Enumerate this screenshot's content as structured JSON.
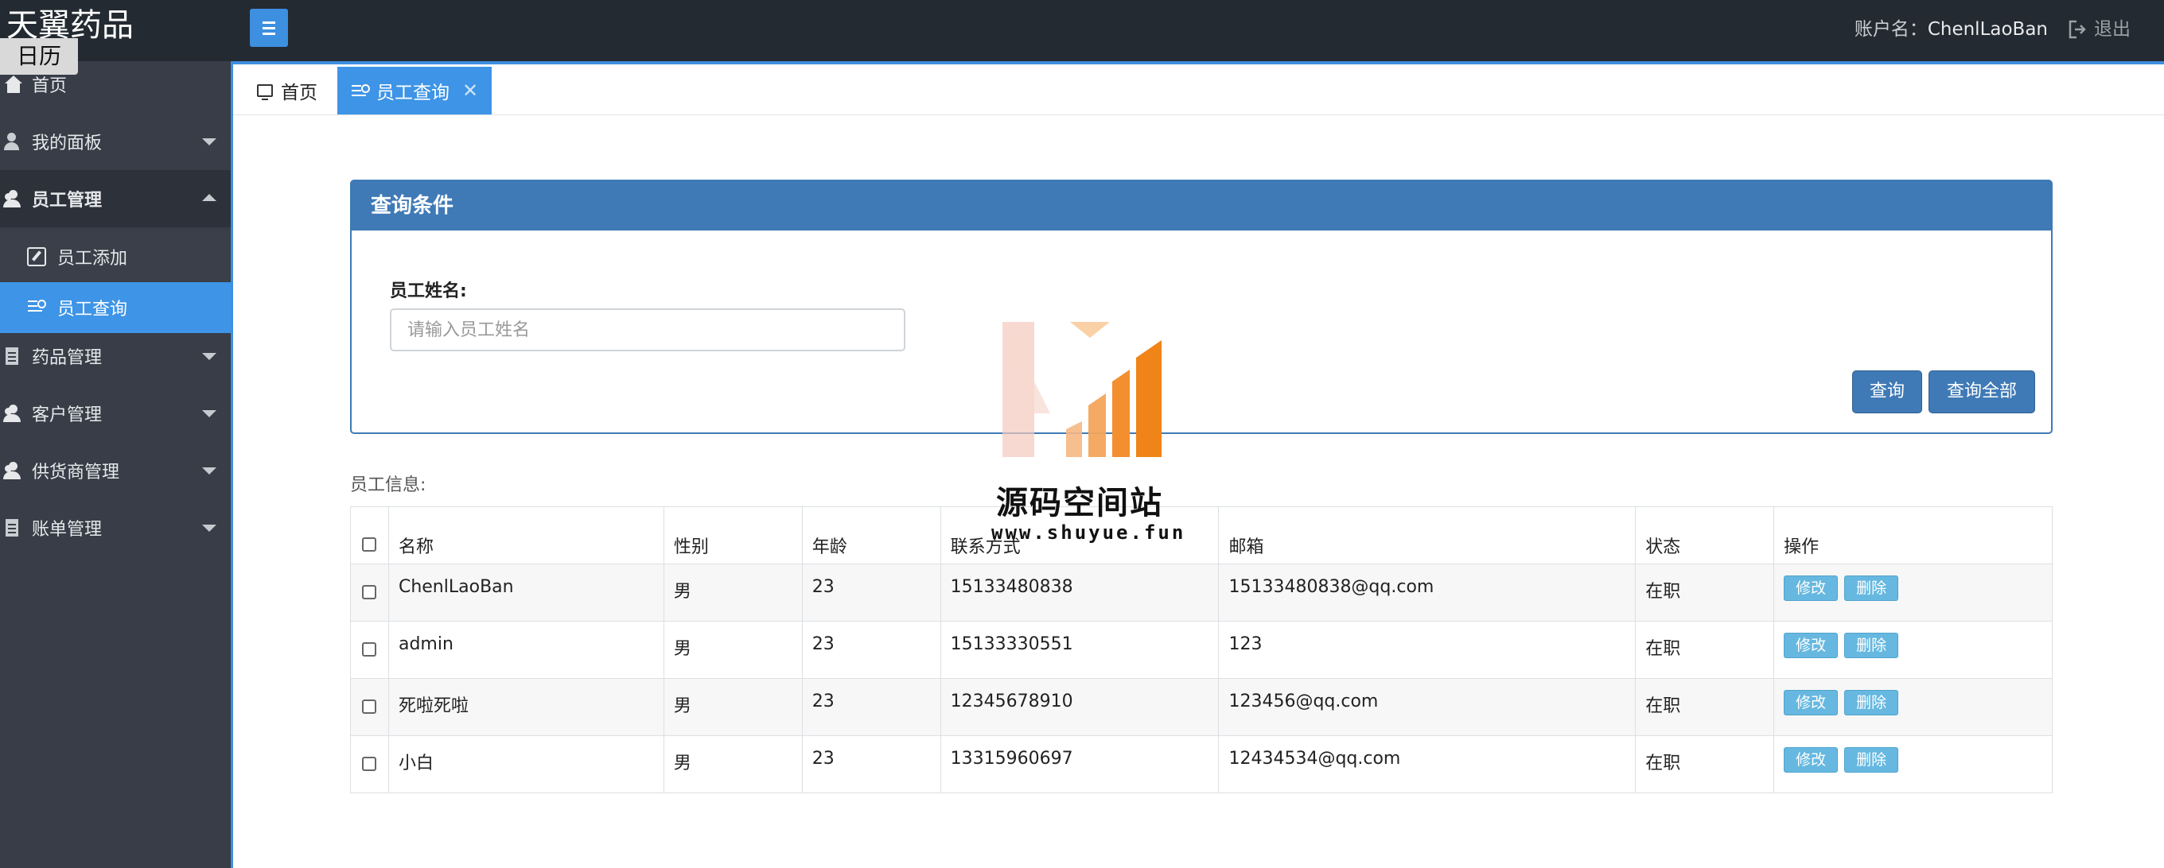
{
  "header": {
    "brand": "天翼药品",
    "account_label": "账户名：",
    "account_name": "ChenlLaoBan",
    "logout_label": "退出"
  },
  "calendar_badge": "日历",
  "sidebar": {
    "items": [
      {
        "label": "首页",
        "icon": "home-icon"
      },
      {
        "label": "我的面板",
        "icon": "user-icon"
      },
      {
        "label": "员工管理",
        "icon": "users-icon",
        "expanded": true
      },
      {
        "label": "药品管理",
        "icon": "doc-icon"
      },
      {
        "label": "客户管理",
        "icon": "users-icon"
      },
      {
        "label": "供货商管理",
        "icon": "users-icon"
      },
      {
        "label": "账单管理",
        "icon": "doc-icon"
      }
    ],
    "sub_items": [
      {
        "label": "员工添加",
        "icon": "edit-icon"
      },
      {
        "label": "员工查询",
        "icon": "search-list-icon",
        "active": true
      }
    ]
  },
  "tabs": [
    {
      "label": "首页",
      "icon": "monitor-icon"
    },
    {
      "label": "员工查询",
      "icon": "search-list-icon",
      "active": true,
      "close": "✕"
    }
  ],
  "query_panel": {
    "title": "查询条件",
    "field_label": "员工姓名:",
    "placeholder": "请输入员工姓名",
    "value": "",
    "query_button": "查询",
    "query_all_button": "查询全部"
  },
  "section_label": "员工信息:",
  "table": {
    "columns": [
      "名称",
      "性别",
      "年龄",
      "联系方式",
      "邮箱",
      "状态",
      "操作"
    ],
    "rows": [
      {
        "name": "ChenlLaoBan",
        "gender": "男",
        "age": "23",
        "phone": "15133480838",
        "email": "15133480838@qq.com",
        "status": "在职"
      },
      {
        "name": "admin",
        "gender": "男",
        "age": "23",
        "phone": "15133330551",
        "email": "123",
        "status": "在职"
      },
      {
        "name": "死啦死啦",
        "gender": "男",
        "age": "23",
        "phone": "12345678910",
        "email": "123456@qq.com",
        "status": "在职"
      },
      {
        "name": "小白",
        "gender": "男",
        "age": "23",
        "phone": "13315960697",
        "email": "12434534@qq.com",
        "status": "在职"
      }
    ],
    "edit_label": "修改",
    "delete_label": "删除"
  },
  "watermark": {
    "title": "源码空间站",
    "url": "www.shuyue.fun"
  },
  "colors": {
    "header_bg": "#232a31",
    "sidebar_bg": "#383d48",
    "accent_blue": "#3e94e6",
    "panel_blue": "#3f7ab6",
    "op_button": "#66b8e0"
  }
}
